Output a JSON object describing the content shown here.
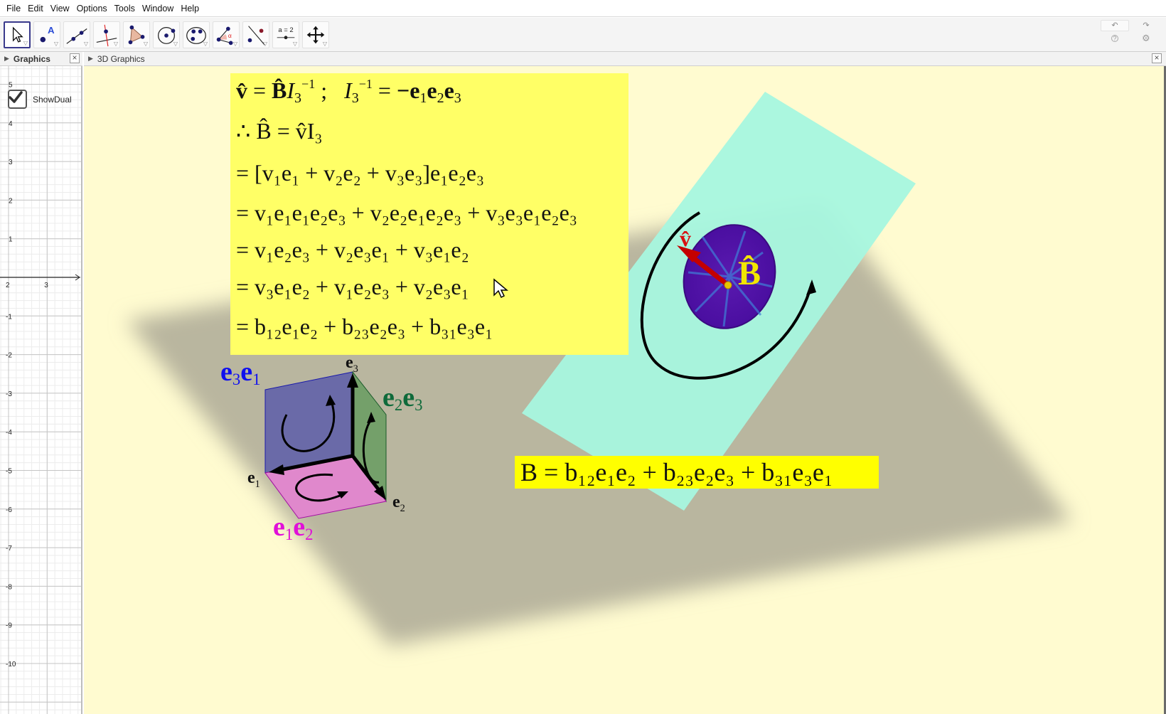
{
  "menu": [
    "File",
    "Edit",
    "View",
    "Options",
    "Tools",
    "Window",
    "Help"
  ],
  "toolbar": {
    "tools": [
      {
        "name": "move-tool",
        "label": "Move"
      },
      {
        "name": "point-tool",
        "label": "Point"
      },
      {
        "name": "line-tool",
        "label": "Line"
      },
      {
        "name": "perpendicular-line-tool",
        "label": "Perpendicular Line"
      },
      {
        "name": "polygon-tool",
        "label": "Polygon"
      },
      {
        "name": "circle-tool",
        "label": "Circle with Center"
      },
      {
        "name": "conic-tool",
        "label": "Conic through 5 points"
      },
      {
        "name": "angle-tool",
        "label": "Angle"
      },
      {
        "name": "reflect-tool",
        "label": "Reflect about Line"
      },
      {
        "name": "slider-tool",
        "label": "Slider",
        "text": "a = 2"
      },
      {
        "name": "move-graphics-view-tool",
        "label": "Move Graphics View"
      }
    ],
    "undo": "↶",
    "redo": "↷",
    "help": "?",
    "settings": "⚙"
  },
  "panels": {
    "left": {
      "title": "Graphics"
    },
    "right": {
      "title": "3D Graphics"
    }
  },
  "graphics2d": {
    "checkbox": {
      "label": "ShowDual",
      "checked": true
    },
    "x_ticks": [
      "2",
      "3"
    ],
    "y_ticks": [
      "5",
      "4",
      "3",
      "2",
      "1",
      "-1",
      "-2",
      "-3",
      "-4",
      "-5",
      "-6",
      "-7",
      "-8",
      "-9",
      "-10"
    ]
  },
  "equations": {
    "line1": {
      "v": "v̂",
      "eq": "=",
      "B": "B̂",
      "I": "I",
      "sub3": "3",
      "supm1": "−1",
      "semi": ";",
      "I2": "I",
      "sub3b": "3",
      "supm1b": "−1",
      "eq2": "=",
      "rhs": "−e",
      "s1": "1",
      "e2": "e",
      "s2": "2",
      "e3": "e",
      "s3": "3"
    },
    "lines_text": [
      "v̂ = B̂I₃⁻¹ ;  I₃⁻¹ = −e₁e₂e₃",
      "∴  B̂ = v̂I₃",
      "= [v₁e₁ + v₂e₂ + v₃e₃]e₁e₂e₃",
      "= v₁e₁e₁e₂e₃ + v₂e₂e₁e₂e₃ + v₃e₃e₁e₂e₃",
      "= v₁e₂e₃ + v₂e₃e₁ + v₃e₁e₂",
      "= v₃e₁e₂ + v₁e₂e₃ + v₂e₃e₁",
      "= b₁₂e₁e₂ + b₂₃e₂e₃ + b₃₁e₃e₁"
    ]
  },
  "bivector_eq": "B = b₁₂e₁e₂ + b₂₃e₂e₃ + b₃₁e₃e₁",
  "cube_labels": {
    "e3e1": {
      "e": "e",
      "a": "3",
      "b": "1"
    },
    "e2e3": {
      "e": "e",
      "a": "2",
      "b": "3"
    },
    "e1e2": {
      "e": "e",
      "a": "1",
      "b": "2"
    },
    "e1": {
      "e": "e",
      "s": "1"
    },
    "e2": {
      "e": "e",
      "s": "2"
    },
    "e3": {
      "e": "e",
      "s": "3"
    }
  },
  "vector_label": "v̂",
  "bivector_label": "B̂",
  "colors": {
    "background3d": "#fffbd0",
    "equation_box": "#ffff66",
    "bivector_box": "#ffff00",
    "plane": "#a6f7df",
    "disk": "#4a0ea0",
    "vector": "#c40000",
    "label_e3e1": "#1010ee",
    "label_e2e3": "#0e6a3a",
    "label_e1e2": "#e010d8",
    "face_e3e1": "#6a6aa8",
    "face_e2e3": "#74a06a",
    "face_e1e2": "#e088cc"
  }
}
